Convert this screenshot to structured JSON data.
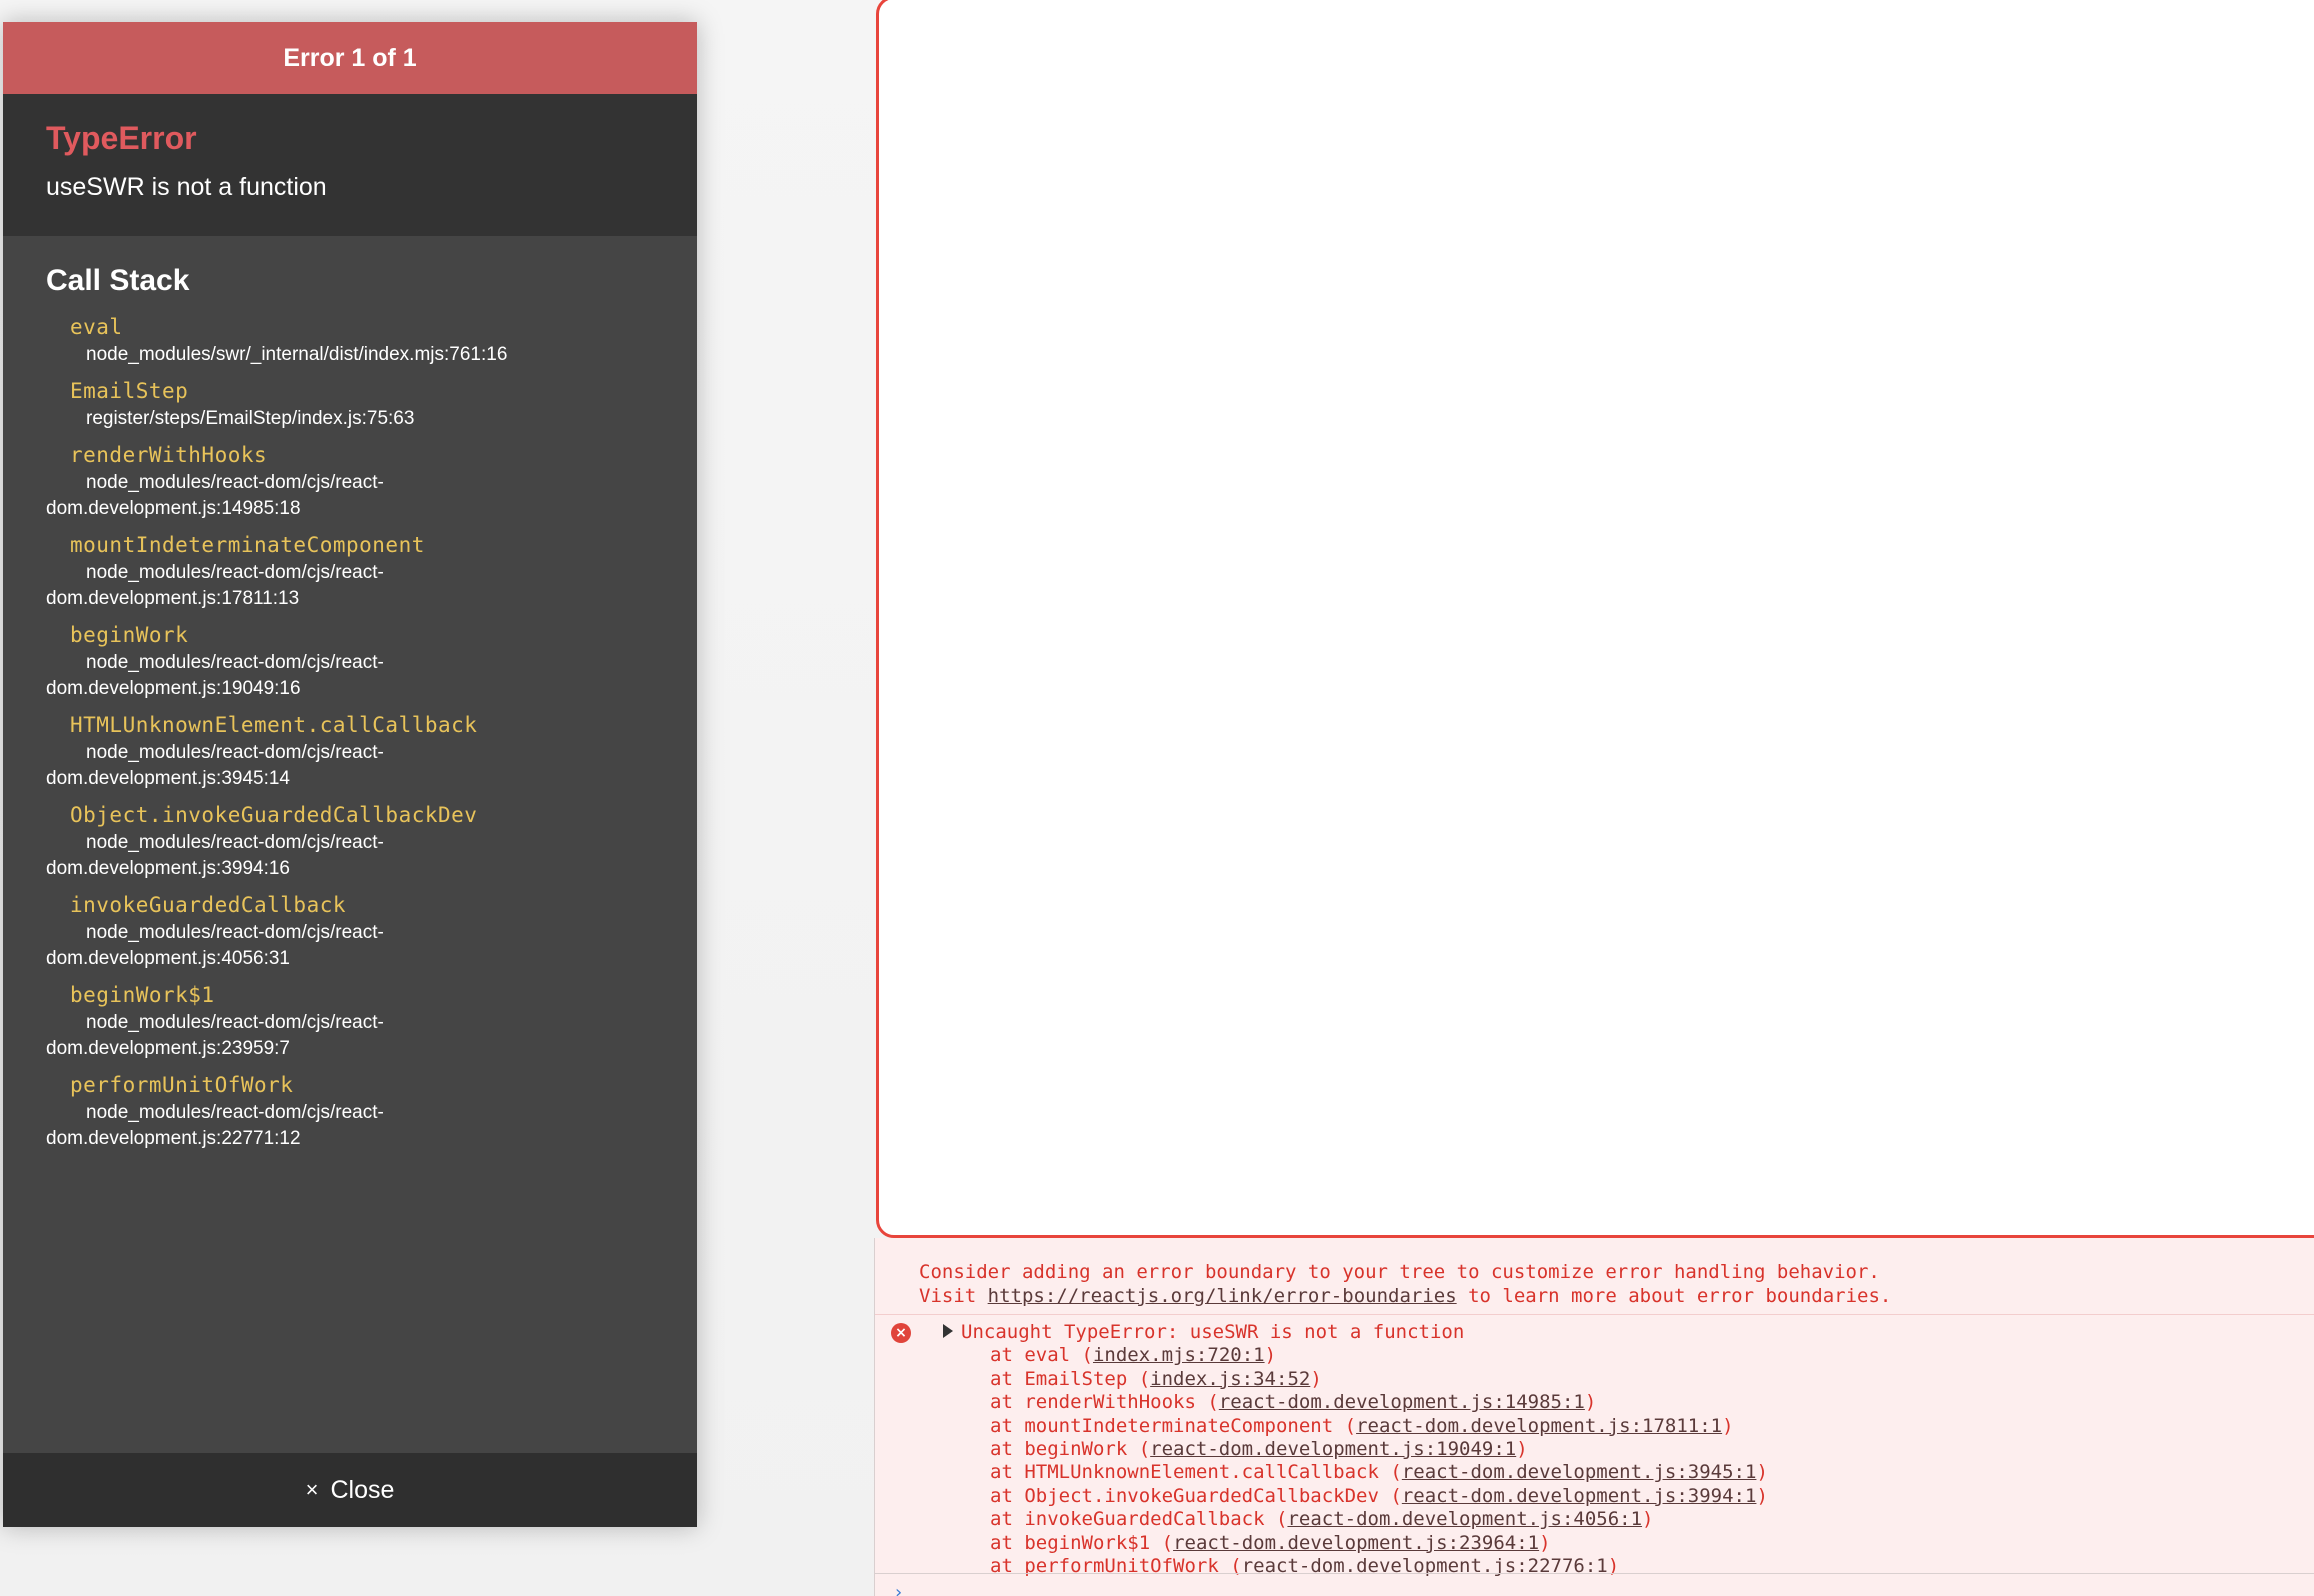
{
  "overlay": {
    "header": "Error 1 of 1",
    "error_type": "TypeError",
    "error_message": "useSWR is not a function",
    "stack_title": "Call Stack",
    "frames": [
      {
        "fn": "eval",
        "file": "node_modules/swr/_internal/dist/index.mjs:761:16"
      },
      {
        "fn": "EmailStep",
        "file": "register/steps/EmailStep/index.js:75:63"
      },
      {
        "fn": "renderWithHooks",
        "file": "node_modules/react-dom/cjs/react-dom.development.js:14985:18"
      },
      {
        "fn": "mountIndeterminateComponent",
        "file": "node_modules/react-dom/cjs/react-dom.development.js:17811:13"
      },
      {
        "fn": "beginWork",
        "file": "node_modules/react-dom/cjs/react-dom.development.js:19049:16"
      },
      {
        "fn": "HTMLUnknownElement.callCallback",
        "file": "node_modules/react-dom/cjs/react-dom.development.js:3945:14"
      },
      {
        "fn": "Object.invokeGuardedCallbackDev",
        "file": "node_modules/react-dom/cjs/react-dom.development.js:3994:16"
      },
      {
        "fn": "invokeGuardedCallback",
        "file": "node_modules/react-dom/cjs/react-dom.development.js:4056:31"
      },
      {
        "fn": "beginWork$1",
        "file": "node_modules/react-dom/cjs/react-dom.development.js:23959:7"
      },
      {
        "fn": "performUnitOfWork",
        "file": "node_modules/react-dom/cjs/react-dom.development.js:22771:12"
      }
    ],
    "close_icon": "×",
    "close_label": "Close"
  },
  "console": {
    "warning_line1": "Consider adding an error boundary to your tree to customize error handling behavior.",
    "warning_visit": "Visit ",
    "warning_link": "https://reactjs.org/link/error-boundaries",
    "warning_rest": " to learn more about error boundaries.",
    "error_icon": "×",
    "error_summary": "Uncaught TypeError: useSWR is not a function",
    "trace": [
      {
        "fn": "eval",
        "loc": "index.mjs:720:1"
      },
      {
        "fn": "EmailStep",
        "loc": "index.js:34:52"
      },
      {
        "fn": "renderWithHooks",
        "loc": "react-dom.development.js:14985:1"
      },
      {
        "fn": "mountIndeterminateComponent",
        "loc": "react-dom.development.js:17811:1"
      },
      {
        "fn": "beginWork",
        "loc": "react-dom.development.js:19049:1"
      },
      {
        "fn": "HTMLUnknownElement.callCallback",
        "loc": "react-dom.development.js:3945:1"
      },
      {
        "fn": "Object.invokeGuardedCallbackDev",
        "loc": "react-dom.development.js:3994:1"
      },
      {
        "fn": "invokeGuardedCallback",
        "loc": "react-dom.development.js:4056:1"
      },
      {
        "fn": "beginWork$1",
        "loc": "react-dom.development.js:23964:1"
      },
      {
        "fn": "performUnitOfWork",
        "loc": "react-dom.development.js:22776:1"
      }
    ]
  },
  "colors": {
    "header_red": "#c65b5c",
    "error_type_red": "#e05a5e",
    "fn_yellow": "#e8c35a",
    "console_red": "#d8332b",
    "frame_border_red": "#e8453c"
  }
}
